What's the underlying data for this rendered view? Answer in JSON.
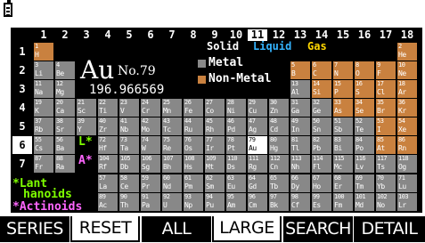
{
  "status": {
    "battery_icon": "battery-icon"
  },
  "columns": [
    "1",
    "2",
    "3",
    "4",
    "5",
    "6",
    "7",
    "8",
    "9",
    "10",
    "11",
    "12",
    "13",
    "14",
    "15",
    "16",
    "17",
    "18"
  ],
  "rows": [
    "1",
    "2",
    "3",
    "4",
    "5",
    "6",
    "7"
  ],
  "selected_element": {
    "symbol": "Au",
    "number_label": "No.79",
    "mass": "196.966569"
  },
  "legend": {
    "solid": "Solid",
    "liquid": "Liquid",
    "gas": "Gas",
    "metal": "Metal",
    "nonmetal": "Non-Metal",
    "colors": {
      "solid": "#ffffff",
      "liquid": "#34b4ff",
      "gas": "#ffd700",
      "metal": "#888888",
      "nonmetal": "#c9813f",
      "lant_marker": "#7fff00",
      "act_marker": "#ff66ff"
    }
  },
  "markers": {
    "lanthanoid": "L*",
    "actinoid": "A*"
  },
  "series_labels": {
    "lant1": "*Lant",
    "lant2": "hanoids",
    "act": "*Actinoids"
  },
  "elements": [
    {
      "z": "1",
      "s": "H",
      "r": 1,
      "c": 1,
      "t": "nonmetal"
    },
    {
      "z": "2",
      "s": "He",
      "r": 1,
      "c": 18,
      "t": "nonmetal"
    },
    {
      "z": "3",
      "s": "Li",
      "r": 2,
      "c": 1,
      "t": "metal"
    },
    {
      "z": "4",
      "s": "Be",
      "r": 2,
      "c": 2,
      "t": "metal"
    },
    {
      "z": "5",
      "s": "B",
      "r": 2,
      "c": 13,
      "t": "nonmetal"
    },
    {
      "z": "6",
      "s": "C",
      "r": 2,
      "c": 14,
      "t": "nonmetal"
    },
    {
      "z": "7",
      "s": "N",
      "r": 2,
      "c": 15,
      "t": "nonmetal"
    },
    {
      "z": "8",
      "s": "O",
      "r": 2,
      "c": 16,
      "t": "nonmetal"
    },
    {
      "z": "9",
      "s": "F",
      "r": 2,
      "c": 17,
      "t": "nonmetal"
    },
    {
      "z": "10",
      "s": "Ne",
      "r": 2,
      "c": 18,
      "t": "nonmetal"
    },
    {
      "z": "11",
      "s": "Na",
      "r": 3,
      "c": 1,
      "t": "metal"
    },
    {
      "z": "12",
      "s": "Mg",
      "r": 3,
      "c": 2,
      "t": "metal"
    },
    {
      "z": "13",
      "s": "Al",
      "r": 3,
      "c": 13,
      "t": "metal"
    },
    {
      "z": "14",
      "s": "Si",
      "r": 3,
      "c": 14,
      "t": "nonmetal"
    },
    {
      "z": "15",
      "s": "P",
      "r": 3,
      "c": 15,
      "t": "nonmetal"
    },
    {
      "z": "16",
      "s": "S",
      "r": 3,
      "c": 16,
      "t": "nonmetal"
    },
    {
      "z": "17",
      "s": "Cl",
      "r": 3,
      "c": 17,
      "t": "nonmetal"
    },
    {
      "z": "18",
      "s": "Ar",
      "r": 3,
      "c": 18,
      "t": "nonmetal"
    },
    {
      "z": "19",
      "s": "K",
      "r": 4,
      "c": 1,
      "t": "metal"
    },
    {
      "z": "20",
      "s": "Ca",
      "r": 4,
      "c": 2,
      "t": "metal"
    },
    {
      "z": "21",
      "s": "Sc",
      "r": 4,
      "c": 3,
      "t": "metal"
    },
    {
      "z": "22",
      "s": "Ti",
      "r": 4,
      "c": 4,
      "t": "metal"
    },
    {
      "z": "23",
      "s": "V",
      "r": 4,
      "c": 5,
      "t": "metal"
    },
    {
      "z": "24",
      "s": "Cr",
      "r": 4,
      "c": 6,
      "t": "metal"
    },
    {
      "z": "25",
      "s": "Mn",
      "r": 4,
      "c": 7,
      "t": "metal"
    },
    {
      "z": "26",
      "s": "Fe",
      "r": 4,
      "c": 8,
      "t": "metal"
    },
    {
      "z": "27",
      "s": "Co",
      "r": 4,
      "c": 9,
      "t": "metal"
    },
    {
      "z": "28",
      "s": "Ni",
      "r": 4,
      "c": 10,
      "t": "metal"
    },
    {
      "z": "29",
      "s": "Cu",
      "r": 4,
      "c": 11,
      "t": "metal"
    },
    {
      "z": "30",
      "s": "Zn",
      "r": 4,
      "c": 12,
      "t": "metal"
    },
    {
      "z": "31",
      "s": "Ga",
      "r": 4,
      "c": 13,
      "t": "metal"
    },
    {
      "z": "32",
      "s": "Ge",
      "r": 4,
      "c": 14,
      "t": "metal"
    },
    {
      "z": "33",
      "s": "As",
      "r": 4,
      "c": 15,
      "t": "nonmetal"
    },
    {
      "z": "34",
      "s": "Se",
      "r": 4,
      "c": 16,
      "t": "nonmetal"
    },
    {
      "z": "35",
      "s": "Br",
      "r": 4,
      "c": 17,
      "t": "nonmetal"
    },
    {
      "z": "36",
      "s": "Kr",
      "r": 4,
      "c": 18,
      "t": "nonmetal"
    },
    {
      "z": "37",
      "s": "Rb",
      "r": 5,
      "c": 1,
      "t": "metal"
    },
    {
      "z": "38",
      "s": "Sr",
      "r": 5,
      "c": 2,
      "t": "metal"
    },
    {
      "z": "39",
      "s": "Y",
      "r": 5,
      "c": 3,
      "t": "metal"
    },
    {
      "z": "40",
      "s": "Zr",
      "r": 5,
      "c": 4,
      "t": "metal"
    },
    {
      "z": "41",
      "s": "Nb",
      "r": 5,
      "c": 5,
      "t": "metal"
    },
    {
      "z": "42",
      "s": "Mo",
      "r": 5,
      "c": 6,
      "t": "metal"
    },
    {
      "z": "43",
      "s": "Tc",
      "r": 5,
      "c": 7,
      "t": "metal"
    },
    {
      "z": "44",
      "s": "Ru",
      "r": 5,
      "c": 8,
      "t": "metal"
    },
    {
      "z": "45",
      "s": "Rh",
      "r": 5,
      "c": 9,
      "t": "metal"
    },
    {
      "z": "46",
      "s": "Pd",
      "r": 5,
      "c": 10,
      "t": "metal"
    },
    {
      "z": "47",
      "s": "Ag",
      "r": 5,
      "c": 11,
      "t": "metal"
    },
    {
      "z": "48",
      "s": "Cd",
      "r": 5,
      "c": 12,
      "t": "metal"
    },
    {
      "z": "49",
      "s": "In",
      "r": 5,
      "c": 13,
      "t": "metal"
    },
    {
      "z": "50",
      "s": "Sn",
      "r": 5,
      "c": 14,
      "t": "metal"
    },
    {
      "z": "51",
      "s": "Sb",
      "r": 5,
      "c": 15,
      "t": "metal"
    },
    {
      "z": "52",
      "s": "Te",
      "r": 5,
      "c": 16,
      "t": "metal"
    },
    {
      "z": "53",
      "s": "I",
      "r": 5,
      "c": 17,
      "t": "nonmetal"
    },
    {
      "z": "54",
      "s": "Xe",
      "r": 5,
      "c": 18,
      "t": "nonmetal"
    },
    {
      "z": "55",
      "s": "Cs",
      "r": 6,
      "c": 1,
      "t": "metal"
    },
    {
      "z": "56",
      "s": "Ba",
      "r": 6,
      "c": 2,
      "t": "metal"
    },
    {
      "z": "72",
      "s": "Hf",
      "r": 6,
      "c": 4,
      "t": "metal"
    },
    {
      "z": "73",
      "s": "Ta",
      "r": 6,
      "c": 5,
      "t": "metal"
    },
    {
      "z": "74",
      "s": "W",
      "r": 6,
      "c": 6,
      "t": "metal"
    },
    {
      "z": "75",
      "s": "Re",
      "r": 6,
      "c": 7,
      "t": "metal"
    },
    {
      "z": "76",
      "s": "Os",
      "r": 6,
      "c": 8,
      "t": "metal"
    },
    {
      "z": "77",
      "s": "Ir",
      "r": 6,
      "c": 9,
      "t": "metal"
    },
    {
      "z": "78",
      "s": "Pt",
      "r": 6,
      "c": 10,
      "t": "metal"
    },
    {
      "z": "79",
      "s": "Au",
      "r": 6,
      "c": 11,
      "t": "metal",
      "sel": true
    },
    {
      "z": "80",
      "s": "Hg",
      "r": 6,
      "c": 12,
      "t": "metal"
    },
    {
      "z": "81",
      "s": "Tl",
      "r": 6,
      "c": 13,
      "t": "metal"
    },
    {
      "z": "82",
      "s": "Pb",
      "r": 6,
      "c": 14,
      "t": "metal"
    },
    {
      "z": "83",
      "s": "Bi",
      "r": 6,
      "c": 15,
      "t": "metal"
    },
    {
      "z": "84",
      "s": "Po",
      "r": 6,
      "c": 16,
      "t": "metal"
    },
    {
      "z": "85",
      "s": "At",
      "r": 6,
      "c": 17,
      "t": "nonmetal"
    },
    {
      "z": "86",
      "s": "Rn",
      "r": 6,
      "c": 18,
      "t": "nonmetal"
    },
    {
      "z": "87",
      "s": "Fr",
      "r": 7,
      "c": 1,
      "t": "metal"
    },
    {
      "z": "88",
      "s": "Ra",
      "r": 7,
      "c": 2,
      "t": "metal"
    },
    {
      "z": "104",
      "s": "Rf",
      "r": 7,
      "c": 4,
      "t": "metal"
    },
    {
      "z": "105",
      "s": "Db",
      "r": 7,
      "c": 5,
      "t": "metal"
    },
    {
      "z": "106",
      "s": "Sg",
      "r": 7,
      "c": 6,
      "t": "metal"
    },
    {
      "z": "107",
      "s": "Bh",
      "r": 7,
      "c": 7,
      "t": "metal"
    },
    {
      "z": "108",
      "s": "Hs",
      "r": 7,
      "c": 8,
      "t": "metal"
    },
    {
      "z": "109",
      "s": "Mt",
      "r": 7,
      "c": 9,
      "t": "metal"
    },
    {
      "z": "110",
      "s": "Ds",
      "r": 7,
      "c": 10,
      "t": "metal"
    },
    {
      "z": "111",
      "s": "Rg",
      "r": 7,
      "c": 11,
      "t": "metal"
    },
    {
      "z": "112",
      "s": "Cn",
      "r": 7,
      "c": 12,
      "t": "metal"
    },
    {
      "z": "113",
      "s": "Nh",
      "r": 7,
      "c": 13,
      "t": "metal"
    },
    {
      "z": "114",
      "s": "Fl",
      "r": 7,
      "c": 14,
      "t": "metal"
    },
    {
      "z": "115",
      "s": "Mc",
      "r": 7,
      "c": 15,
      "t": "metal"
    },
    {
      "z": "116",
      "s": "Lv",
      "r": 7,
      "c": 16,
      "t": "metal"
    },
    {
      "z": "117",
      "s": "Ts",
      "r": 7,
      "c": 17,
      "t": "metal"
    },
    {
      "z": "118",
      "s": "Og",
      "r": 7,
      "c": 18,
      "t": "metal"
    },
    {
      "z": "57",
      "s": "La",
      "r": 9,
      "c": 4,
      "t": "metal"
    },
    {
      "z": "58",
      "s": "Ce",
      "r": 9,
      "c": 5,
      "t": "metal"
    },
    {
      "z": "59",
      "s": "Pr",
      "r": 9,
      "c": 6,
      "t": "metal"
    },
    {
      "z": "60",
      "s": "Nd",
      "r": 9,
      "c": 7,
      "t": "metal"
    },
    {
      "z": "61",
      "s": "Pm",
      "r": 9,
      "c": 8,
      "t": "metal"
    },
    {
      "z": "62",
      "s": "Sm",
      "r": 9,
      "c": 9,
      "t": "metal"
    },
    {
      "z": "63",
      "s": "Eu",
      "r": 9,
      "c": 10,
      "t": "metal"
    },
    {
      "z": "64",
      "s": "Gd",
      "r": 9,
      "c": 11,
      "t": "metal"
    },
    {
      "z": "65",
      "s": "Tb",
      "r": 9,
      "c": 12,
      "t": "metal"
    },
    {
      "z": "66",
      "s": "Dy",
      "r": 9,
      "c": 13,
      "t": "metal"
    },
    {
      "z": "67",
      "s": "Ho",
      "r": 9,
      "c": 14,
      "t": "metal"
    },
    {
      "z": "68",
      "s": "Er",
      "r": 9,
      "c": 15,
      "t": "metal"
    },
    {
      "z": "69",
      "s": "Tm",
      "r": 9,
      "c": 16,
      "t": "metal"
    },
    {
      "z": "70",
      "s": "Yb",
      "r": 9,
      "c": 17,
      "t": "metal"
    },
    {
      "z": "71",
      "s": "Lu",
      "r": 9,
      "c": 18,
      "t": "metal"
    },
    {
      "z": "89",
      "s": "Ac",
      "r": 10,
      "c": 4,
      "t": "metal"
    },
    {
      "z": "90",
      "s": "Th",
      "r": 10,
      "c": 5,
      "t": "metal"
    },
    {
      "z": "91",
      "s": "Pa",
      "r": 10,
      "c": 6,
      "t": "metal"
    },
    {
      "z": "92",
      "s": "U",
      "r": 10,
      "c": 7,
      "t": "metal"
    },
    {
      "z": "93",
      "s": "Np",
      "r": 10,
      "c": 8,
      "t": "metal"
    },
    {
      "z": "94",
      "s": "Pu",
      "r": 10,
      "c": 9,
      "t": "metal"
    },
    {
      "z": "95",
      "s": "Am",
      "r": 10,
      "c": 10,
      "t": "metal"
    },
    {
      "z": "96",
      "s": "Cm",
      "r": 10,
      "c": 11,
      "t": "metal"
    },
    {
      "z": "97",
      "s": "Bk",
      "r": 10,
      "c": 12,
      "t": "metal"
    },
    {
      "z": "98",
      "s": "Cf",
      "r": 10,
      "c": 13,
      "t": "metal"
    },
    {
      "z": "99",
      "s": "Es",
      "r": 10,
      "c": 14,
      "t": "metal"
    },
    {
      "z": "100",
      "s": "Fm",
      "r": 10,
      "c": 15,
      "t": "metal"
    },
    {
      "z": "101",
      "s": "Md",
      "r": 10,
      "c": 16,
      "t": "metal"
    },
    {
      "z": "102",
      "s": "No",
      "r": 10,
      "c": 17,
      "t": "metal"
    },
    {
      "z": "103",
      "s": "Lr",
      "r": 10,
      "c": 18,
      "t": "metal"
    }
  ],
  "softkeys": [
    {
      "label": "SERIES",
      "name": "series-softkey",
      "style": "fill"
    },
    {
      "label": "RESET",
      "name": "reset-softkey",
      "style": "out"
    },
    {
      "label": "ALL",
      "name": "all-softkey",
      "style": "fill"
    },
    {
      "label": "LARGE",
      "name": "large-softkey",
      "style": "out"
    },
    {
      "label": "SEARCH",
      "name": "search-softkey",
      "style": "fill"
    },
    {
      "label": "DETAIL",
      "name": "detail-softkey",
      "style": "fill"
    }
  ]
}
